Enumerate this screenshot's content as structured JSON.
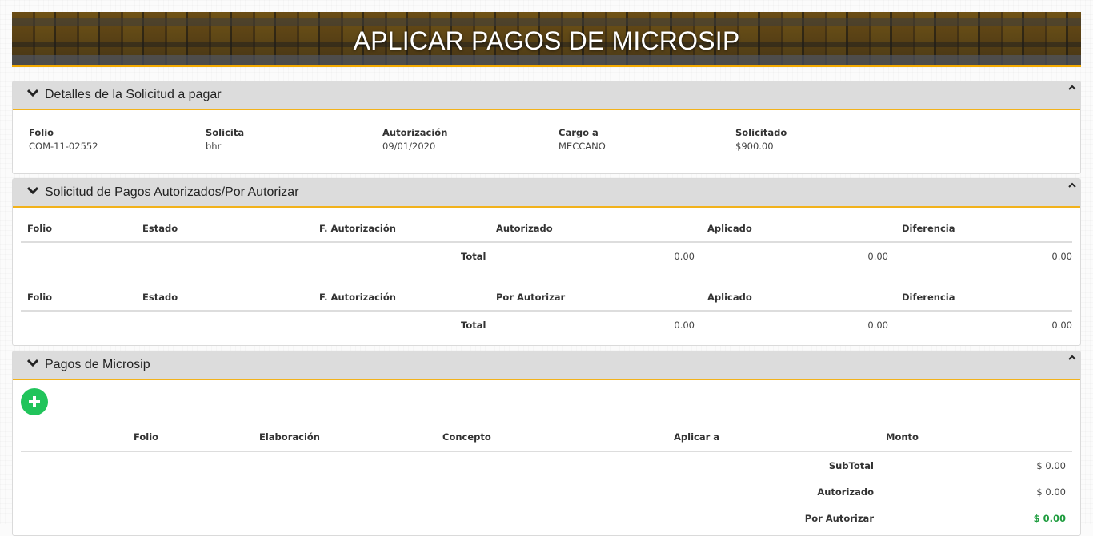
{
  "header": {
    "title": "APLICAR PAGOS DE MICROSIP"
  },
  "detalles": {
    "title": "Detalles de la Solicitud a pagar",
    "fields": [
      {
        "label": "Folio",
        "value": "COM-11-02552"
      },
      {
        "label": "Solicita",
        "value": "bhr"
      },
      {
        "label": "Autorización",
        "value": "09/01/2020"
      },
      {
        "label": "Cargo a",
        "value": "MECCANO"
      },
      {
        "label": "Solicitado",
        "value": "$900.00"
      }
    ]
  },
  "solicitud_pagos": {
    "title": "Solicitud de Pagos Autorizados/Por Autorizar",
    "autorizados": {
      "columns": [
        "Folio",
        "Estado",
        "F. Autorización",
        "Autorizado",
        "Aplicado",
        "Diferencia"
      ],
      "total_label": "Total",
      "totals": [
        "0.00",
        "0.00",
        "0.00"
      ]
    },
    "por_autorizar": {
      "columns": [
        "Folio",
        "Estado",
        "F. Autorización",
        "Por Autorizar",
        "Aplicado",
        "Diferencia"
      ],
      "total_label": "Total",
      "totals": [
        "0.00",
        "0.00",
        "0.00"
      ]
    }
  },
  "pagos_microsip": {
    "title": "Pagos de Microsip",
    "add_icon": "plus-icon",
    "columns": [
      "Folio",
      "Elaboración",
      "Concepto",
      "Aplicar a",
      "Monto"
    ],
    "summary": [
      {
        "label": "SubTotal",
        "value": "$ 0.00"
      },
      {
        "label": "Autorizado",
        "value": "$ 0.00"
      },
      {
        "label": "Por Autorizar",
        "value": "$ 0.00"
      }
    ]
  },
  "colors": {
    "accent": "#f2b21b",
    "header_bg": "#dcdcdc",
    "add_button": "#21c45b",
    "positive": "#1e9c3e"
  }
}
